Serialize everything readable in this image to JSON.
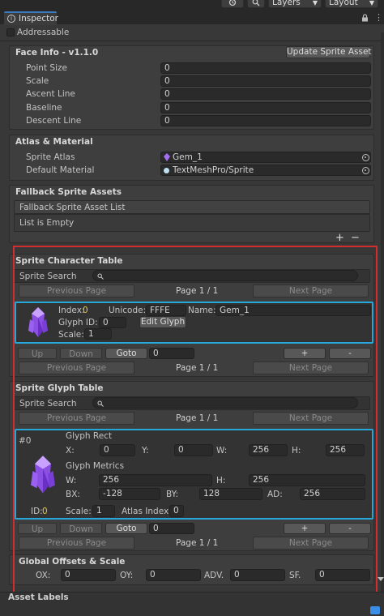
{
  "toolbar": {
    "layers": "Layers",
    "layout": "Layout"
  },
  "tab": {
    "title": "Inspector",
    "addressable": "Addressable"
  },
  "face_info": {
    "header": "Face Info - v1.1.0",
    "update_button": "Update Sprite Asset",
    "rows": [
      {
        "label": "Point Size",
        "value": "0"
      },
      {
        "label": "Scale",
        "value": "0"
      },
      {
        "label": "Ascent Line",
        "value": "0"
      },
      {
        "label": "Baseline",
        "value": "0"
      },
      {
        "label": "Descent Line",
        "value": "0"
      }
    ]
  },
  "atlas": {
    "header": "Atlas & Material",
    "sprite_atlas_label": "Sprite Atlas",
    "sprite_atlas_value": "Gem_1",
    "material_label": "Default Material",
    "material_value": "TextMeshPro/Sprite"
  },
  "fallback": {
    "header": "Fallback Sprite Assets",
    "list_title": "Fallback Sprite Asset List",
    "empty": "List is Empty",
    "plus": "+",
    "minus": "−"
  },
  "char_table": {
    "header": "Sprite Character Table",
    "search_label": "Sprite Search",
    "prev": "Previous Page",
    "page": "Page 1 / 1",
    "next": "Next Page",
    "index_label": "Index:",
    "index_value": "0",
    "unicode_label": "Unicode:",
    "unicode_value": "FFFE",
    "name_label": "Name:",
    "name_value": "Gem_1",
    "glyph_id_label": "Glyph ID:",
    "glyph_id_value": "0",
    "edit_glyph": "Edit Glyph",
    "scale_label": "Scale:",
    "scale_value": "1",
    "up": "Up",
    "down": "Down",
    "goto": "Goto",
    "goto_value": "0",
    "add": "+",
    "remove": "-",
    "prev2": "Previous Page",
    "page2": "Page 1 / 1",
    "next2": "Next Page"
  },
  "glyph_table": {
    "header": "Sprite Glyph Table",
    "search_label": "Sprite Search",
    "prev": "Previous Page",
    "page": "Page 1 / 1",
    "next": "Next Page",
    "hash": "#0",
    "rect_title": "Glyph Rect",
    "x_label": "X:",
    "x_value": "0",
    "y_label": "Y:",
    "y_value": "0",
    "w_label": "W:",
    "w_value": "256",
    "h_label": "H:",
    "h_value": "256",
    "metrics_title": "Glyph Metrics",
    "mw_label": "W:",
    "mw_value": "256",
    "mh_label": "H:",
    "mh_value": "256",
    "bx_label": "BX:",
    "bx_value": "-128",
    "by_label": "BY:",
    "by_value": "128",
    "ad_label": "AD:",
    "ad_value": "256",
    "id_label": "ID:",
    "id_value": "0",
    "scale_label": "Scale:",
    "scale_value": "1",
    "atlas_index_label": "Atlas Index:",
    "atlas_index_value": "0",
    "up": "Up",
    "down": "Down",
    "goto": "Goto",
    "goto_value": "0",
    "add": "+",
    "remove": "-",
    "prev2": "Previous Page",
    "page2": "Page 1 / 1",
    "next2": "Next Page"
  },
  "offsets": {
    "header": "Global Offsets & Scale",
    "ox_label": "OX:",
    "ox_value": "0",
    "oy_label": "OY:",
    "oy_value": "0",
    "adv_label": "ADV.",
    "adv_value": "0",
    "sf_label": "SF.",
    "sf_value": "0"
  },
  "asset_labels": "Asset Labels",
  "colors": {
    "accent_blue": "#27a7d8",
    "highlight_red": "#d12f2f",
    "index_yellow": "#e6c84a"
  }
}
